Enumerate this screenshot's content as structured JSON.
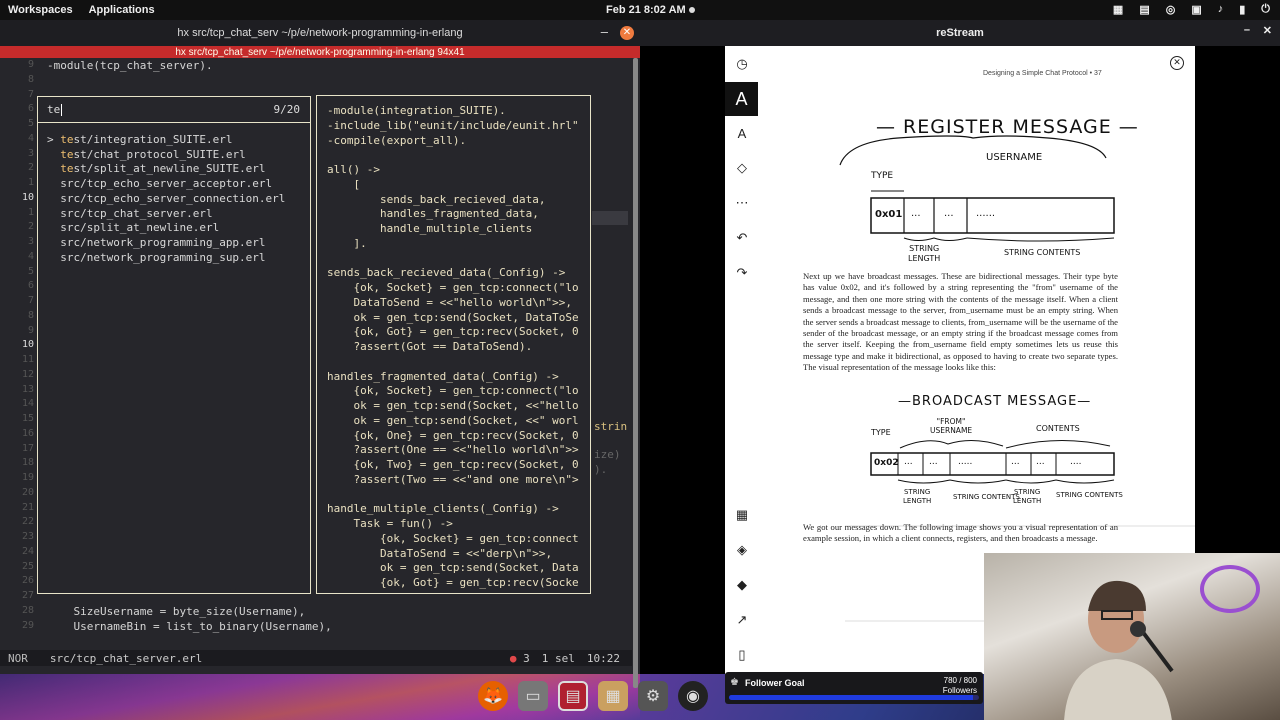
{
  "topbar": {
    "workspaces": "Workspaces",
    "applications": "Applications",
    "datetime": "Feb 21  8:02 AM"
  },
  "terminal": {
    "title": "hx src/tcp_chat_serv ~/p/e/network-programming-in-erlang",
    "tab_title": "hx src/tcp_chat_serv ~/p/e/network-programming-in-erlang 94x41",
    "background_lines": [
      {
        "n": "9",
        "text": "-module(tcp_chat_server)."
      },
      {
        "n": "8",
        "text": ""
      },
      {
        "n": "7",
        "text": ""
      },
      {
        "n": "6",
        "text": ""
      },
      {
        "n": "5",
        "text": ""
      },
      {
        "n": "4",
        "text": ""
      },
      {
        "n": "3",
        "text": ""
      },
      {
        "n": "2",
        "text": ""
      },
      {
        "n": "1",
        "text": ""
      },
      {
        "n": "10",
        "text": ""
      },
      {
        "n": "1",
        "text": ""
      },
      {
        "n": "2",
        "text": ""
      },
      {
        "n": "3",
        "text": ""
      },
      {
        "n": "4",
        "text": ""
      },
      {
        "n": "5",
        "text": ""
      },
      {
        "n": "6",
        "text": ""
      },
      {
        "n": "7",
        "text": ""
      },
      {
        "n": "8",
        "text": ""
      },
      {
        "n": "9",
        "text": ""
      },
      {
        "n": "10",
        "text": ""
      },
      {
        "n": "11",
        "text": ""
      },
      {
        "n": "12",
        "text": ""
      },
      {
        "n": "13",
        "text": ""
      },
      {
        "n": "14",
        "text": ""
      },
      {
        "n": "15",
        "text": ""
      },
      {
        "n": "16",
        "text": ""
      },
      {
        "n": "17",
        "text": ""
      },
      {
        "n": "18",
        "text": ""
      },
      {
        "n": "19",
        "text": ""
      },
      {
        "n": "20",
        "text": ""
      },
      {
        "n": "21",
        "text": ""
      },
      {
        "n": "22",
        "text": ""
      },
      {
        "n": "23",
        "text": ""
      },
      {
        "n": "24",
        "text": ""
      },
      {
        "n": "25",
        "text": ""
      },
      {
        "n": "26",
        "text": ""
      },
      {
        "n": "27",
        "text": ""
      },
      {
        "n": "28",
        "text": "    SizeUsername = byte_size(Username),"
      },
      {
        "n": "29",
        "text": "    UsernameBin = list_to_binary(Username),"
      }
    ],
    "side_fragments": [
      "strin",
      "ize)",
      ")."
    ],
    "status": {
      "mode": "NOR",
      "file": "src/tcp_chat_server.erl",
      "errors": "3",
      "selection": "1 sel",
      "position": "10:22"
    }
  },
  "picker": {
    "query": "te",
    "count": "9/20",
    "items": [
      {
        "prefix": "> ",
        "hl": "te",
        "rest": "st/integration_SUITE.erl"
      },
      {
        "prefix": "  ",
        "hl": "te",
        "rest": "st/chat_protocol_SUITE.erl"
      },
      {
        "prefix": "  ",
        "hl": "te",
        "rest": "st/split_at_newline_SUITE.erl"
      },
      {
        "prefix": "  ",
        "hl": "",
        "rest": "src/tcp_echo_server_acceptor.erl"
      },
      {
        "prefix": "  ",
        "hl": "",
        "rest": "src/tcp_echo_server_connection.erl"
      },
      {
        "prefix": "  ",
        "hl": "",
        "rest": "src/tcp_chat_server.erl"
      },
      {
        "prefix": "  ",
        "hl": "",
        "rest": "src/split_at_newline.erl"
      },
      {
        "prefix": "  ",
        "hl": "",
        "rest": "src/network_programming_app.erl"
      },
      {
        "prefix": "  ",
        "hl": "",
        "rest": "src/network_programming_sup.erl"
      }
    ]
  },
  "preview": {
    "lines": [
      "-module(integration_SUITE).",
      "-include_lib(\"eunit/include/eunit.hrl\"",
      "-compile(export_all).",
      "",
      "all() ->",
      "    [",
      "        sends_back_recieved_data,",
      "        handles_fragmented_data,",
      "        handle_multiple_clients",
      "    ].",
      "",
      "sends_back_recieved_data(_Config) ->",
      "    {ok, Socket} = gen_tcp:connect(\"lo",
      "    DataToSend = <<\"hello world\\n\">>,",
      "    ok = gen_tcp:send(Socket, DataToSe",
      "    {ok, Got} = gen_tcp:recv(Socket, 0",
      "    ?assert(Got == DataToSend).",
      "",
      "handles_fragmented_data(_Config) ->",
      "    {ok, Socket} = gen_tcp:connect(\"lo",
      "    ok = gen_tcp:send(Socket, <<\"hello",
      "    ok = gen_tcp:send(Socket, <<\" worl",
      "    {ok, One} = gen_tcp:recv(Socket, 0",
      "    ?assert(One == <<\"hello world\\n\">>",
      "    {ok, Two} = gen_tcp:recv(Socket, 0",
      "    ?assert(Two == <<\"and one more\\n\">",
      "",
      "handle_multiple_clients(_Config) ->",
      "    Task = fun() ->",
      "        {ok, Socket} = gen_tcp:connect",
      "        DataToSend = <<\"derp\\n\">>,",
      "        ok = gen_tcp:send(Socket, Data",
      "        {ok, Got} = gen_tcp:recv(Socke"
    ]
  },
  "restream": {
    "title": "reStream",
    "header": "Designing a Simple Chat Protocol • 37",
    "register": {
      "title": "— REGISTER MESSAGE —",
      "username": "USERNAME",
      "type": "TYPE",
      "byte": "0x01",
      "cells": [
        "...",
        "...",
        "......"
      ],
      "string_length": "STRING\nLENGTH",
      "string_contents": "STRING CONTENTS"
    },
    "paragraph1": "Next up we have broadcast messages. These are bidirectional messages. Their type byte has value 0x02, and it's followed by a string representing the \"from\" username of the message, and then one more string with the contents of the message itself. When a client sends a broadcast message to the server, from_username must be an empty string. When the server sends a broadcast message to clients, from_username will be the username of the sender of the broadcast message, or an empty string if the broadcast message comes from the server itself. Keeping the from_username field empty sometimes lets us reuse this message type and make it bidirectional, as opposed to having to create two separate types. The visual representation of the message looks like this:",
    "broadcast": {
      "title": "—BROADCAST MESSAGE—",
      "from": "\"FROM\"\nUSERNAME",
      "contents": "CONTENTS",
      "type": "TYPE",
      "byte": "0x02",
      "cells": [
        "...",
        "...",
        ".....",
        "...",
        "...",
        "...."
      ],
      "labels": [
        "STRING\nLENGTH",
        "STRING CONTENTS",
        "STRING\nLENGTH",
        "STRING CONTENTS"
      ]
    },
    "paragraph2": "We got our messages down. The following image shows you a visual representation of an example session, in which a client connects, registers, and then broadcasts a message."
  },
  "goal": {
    "label": "Follower Goal",
    "count": "780 / 800",
    "unit": "Followers",
    "progress": 0.975
  },
  "colors": {
    "accent_red": "#c52b2b",
    "picker_border": "#e8e4c9",
    "goal_fill": "#1f3be0"
  }
}
